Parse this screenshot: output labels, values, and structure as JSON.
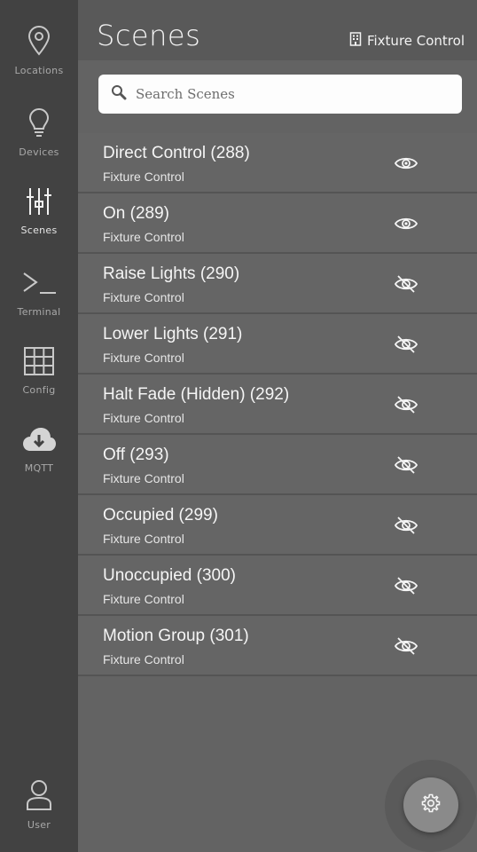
{
  "sidebar": {
    "items": [
      {
        "label": "Locations",
        "icon": "location-pin-icon"
      },
      {
        "label": "Devices",
        "icon": "lightbulb-icon"
      },
      {
        "label": "Scenes",
        "icon": "sliders-icon",
        "active": true
      },
      {
        "label": "Terminal",
        "icon": "terminal-icon"
      },
      {
        "label": "Config",
        "icon": "grid-icon"
      },
      {
        "label": "MQTT",
        "icon": "cloud-download-icon"
      }
    ],
    "user": {
      "label": "User",
      "icon": "user-icon"
    }
  },
  "header": {
    "title": "Scenes",
    "context_label": "Fixture Control",
    "context_icon": "building-icon"
  },
  "search": {
    "placeholder": "Search Scenes",
    "value": ""
  },
  "scenes": [
    {
      "title": "Direct Control (288)",
      "subtitle": "Fixture Control",
      "visible": true
    },
    {
      "title": "On (289)",
      "subtitle": "Fixture Control",
      "visible": true
    },
    {
      "title": "Raise Lights (290)",
      "subtitle": "Fixture Control",
      "visible": false
    },
    {
      "title": "Lower Lights (291)",
      "subtitle": "Fixture Control",
      "visible": false
    },
    {
      "title": "Halt Fade (Hidden) (292)",
      "subtitle": "Fixture Control",
      "visible": false
    },
    {
      "title": "Off (293)",
      "subtitle": "Fixture Control",
      "visible": false
    },
    {
      "title": "Occupied (299)",
      "subtitle": "Fixture Control",
      "visible": false
    },
    {
      "title": "Unoccupied (300)",
      "subtitle": "Fixture Control",
      "visible": false
    },
    {
      "title": "Motion Group (301)",
      "subtitle": "Fixture Control",
      "visible": false
    }
  ],
  "fab": {
    "icon": "gear-icon"
  },
  "colors": {
    "sidebar_bg": "#424242",
    "header_bg": "#595959",
    "content_bg": "#636363",
    "row_bg": "#656565",
    "text_primary": "#f5f5f5"
  }
}
